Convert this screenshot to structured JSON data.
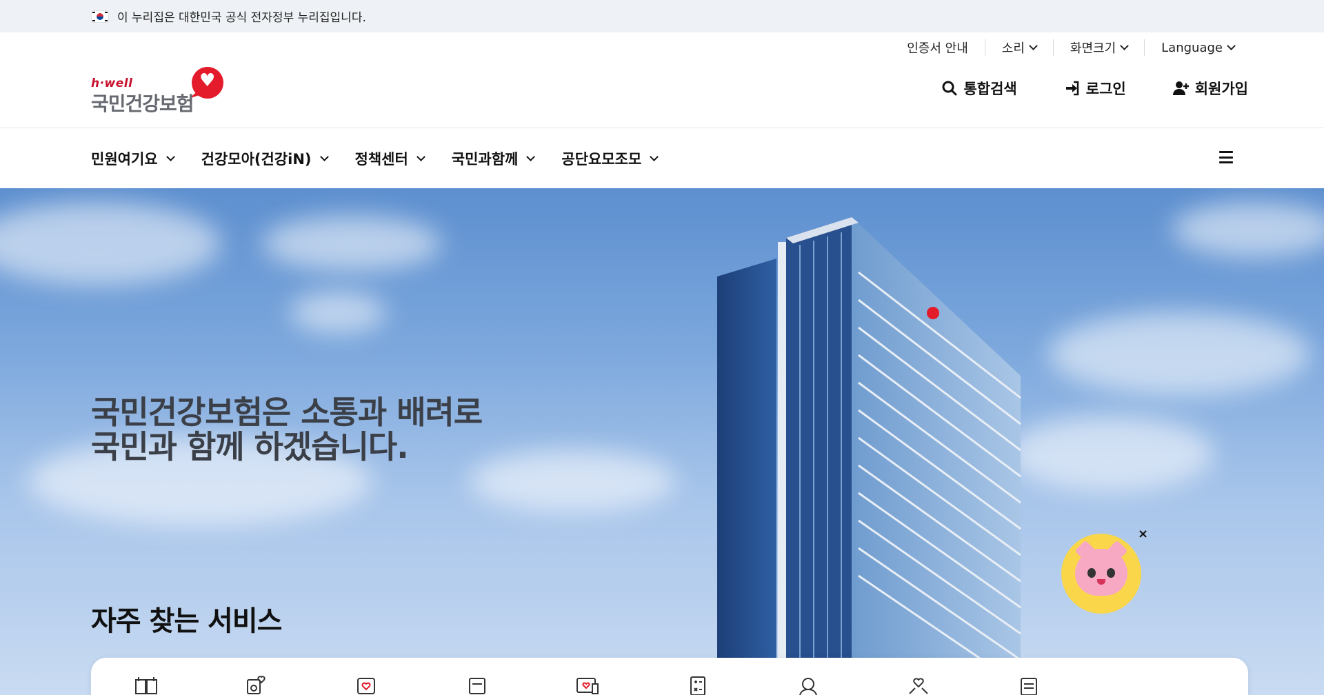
{
  "gov_banner": {
    "text": "이 누리집은 대한민국 공식 전자정부 누리집입니다."
  },
  "header": {
    "logo": {
      "tagline": "h·well",
      "name": "국민건강보험"
    },
    "utility": {
      "cert": "인증서 안내",
      "sound": "소리",
      "zoom": "화면크기",
      "language": "Language"
    },
    "actions": {
      "search": "통합검색",
      "login": "로그인",
      "signup": "회원가입"
    }
  },
  "nav": {
    "items": [
      {
        "label": "민원여기요"
      },
      {
        "label": "건강모아(건강iN)"
      },
      {
        "label": "정책센터"
      },
      {
        "label": "국민과함께"
      },
      {
        "label": "공단요모조모"
      }
    ]
  },
  "hero": {
    "line1": "국민건강보험은 소통과 배려로",
    "line2": "국민과 함께 하겠습니다."
  },
  "services": {
    "title": "자주 찾는 서비스",
    "icons": [
      "calendar-won-icon",
      "health-check-icon",
      "heart-card-icon",
      "document-icon",
      "heart-monitor-icon",
      "calculator-icon",
      "search-person-icon",
      "heart-hands-icon",
      "form-icon"
    ]
  },
  "chatbot": {
    "close": "×"
  },
  "colors": {
    "brand_red": "#e41b2b",
    "gov_bar": "#eef1f5",
    "chatbot_yellow": "#f9d64a"
  }
}
